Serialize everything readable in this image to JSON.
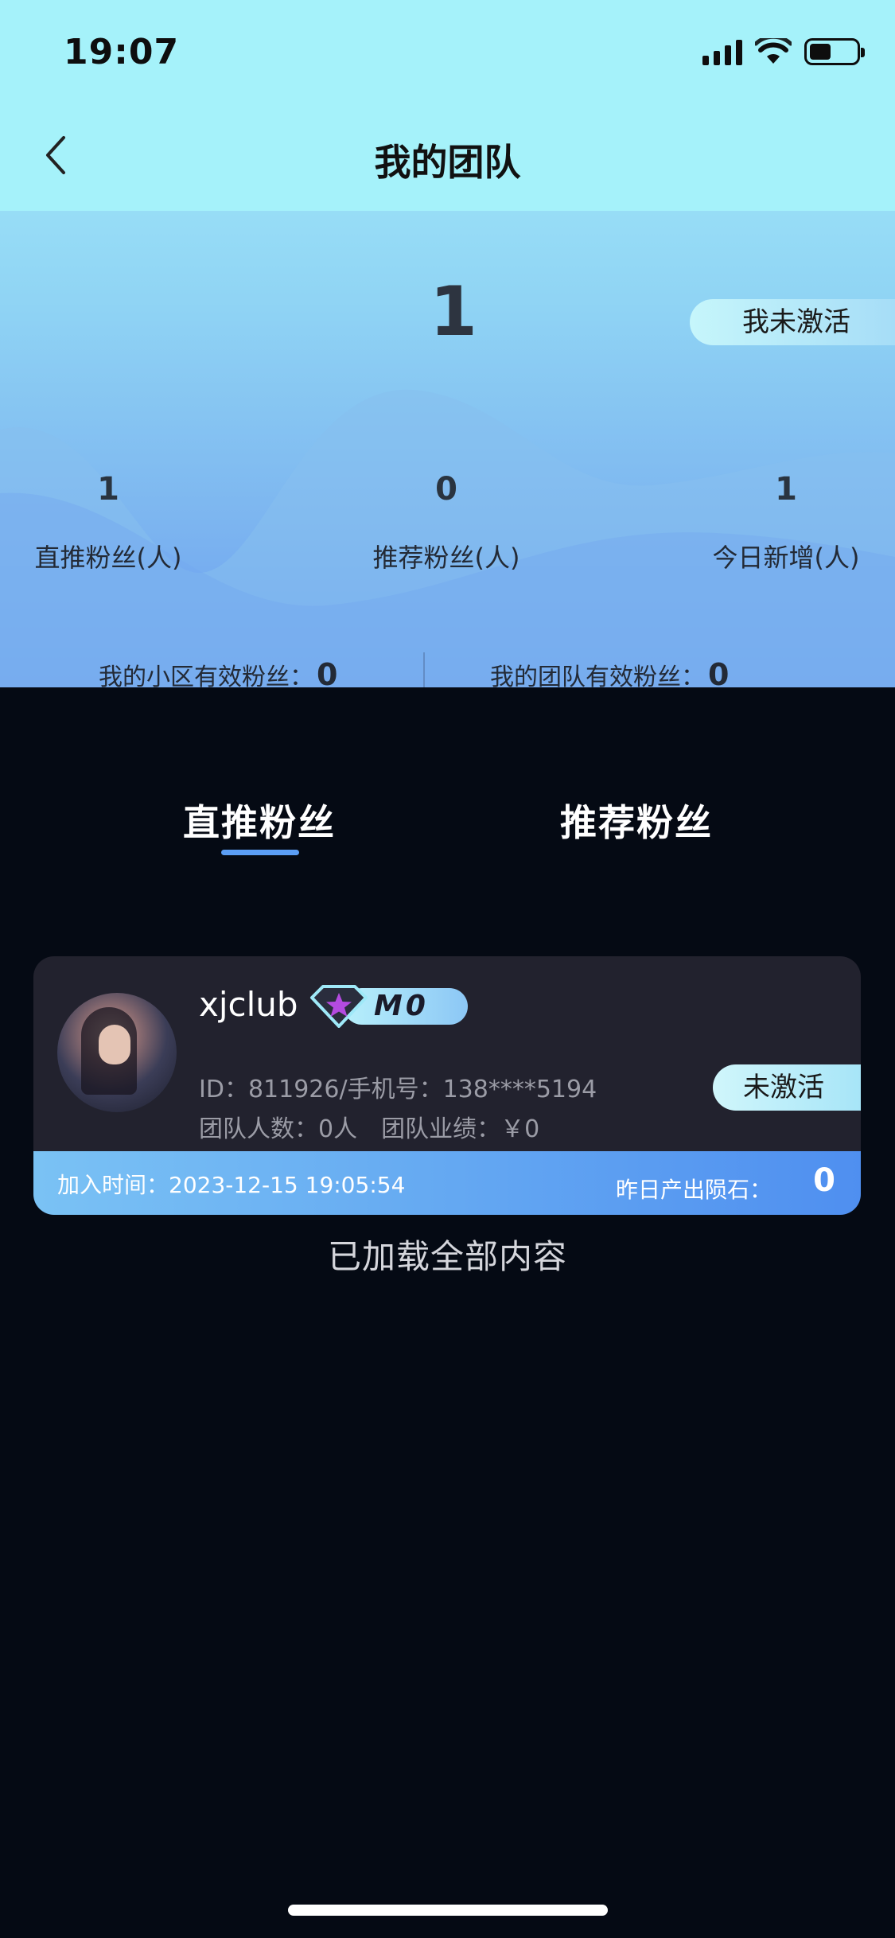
{
  "status_bar": {
    "time": "19:07"
  },
  "nav": {
    "title": "我的团队"
  },
  "summary": {
    "total": "1",
    "activation_tag": "我未激活",
    "stats": [
      {
        "value": "1",
        "label": "直推粉丝(人)"
      },
      {
        "value": "0",
        "label": "推荐粉丝(人)"
      },
      {
        "value": "1",
        "label": "今日新增(人)"
      }
    ],
    "valid_small_label": "我的小区有效粉丝：",
    "valid_small_value": "0",
    "valid_team_label": "我的团队有效粉丝：",
    "valid_team_value": "0"
  },
  "tabs": [
    {
      "label": "直推粉丝",
      "active": true
    },
    {
      "label": "推荐粉丝",
      "active": false
    }
  ],
  "members": [
    {
      "username": "xjclub",
      "level": "M0",
      "id_phone": "ID：811926/手机号：138****5194",
      "team_line": "团队人数：0人　团队业绩：￥0",
      "status": "未激活",
      "join_time": "加入时间：2023-12-15 19:05:54",
      "yesterday_label": "昨日产出陨石：",
      "yesterday_value": "0"
    }
  ],
  "footer": {
    "loaded_all": "已加载全部内容"
  },
  "colors": {
    "accent": "#5b9ef5",
    "background": "#050a14",
    "card": "#22222e",
    "badge_star": "#b44be0"
  }
}
